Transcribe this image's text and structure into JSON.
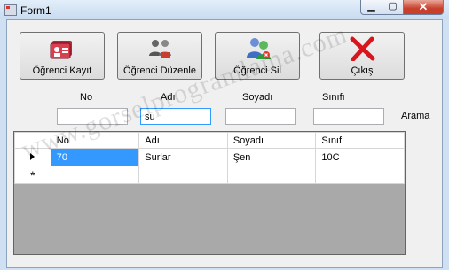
{
  "window": {
    "title": "Form1",
    "controls": {
      "minimize": "▁",
      "maximize": "▢",
      "close": "✕"
    }
  },
  "toolbar": {
    "buttons": [
      {
        "label": "Öğrenci Kayıt",
        "icon": "id-card-icon"
      },
      {
        "label": "Öğrenci Düzenle",
        "icon": "users-edit-icon"
      },
      {
        "label": "Öğrenci Sil",
        "icon": "user-delete-icon"
      },
      {
        "label": "Çıkış",
        "icon": "red-x-icon"
      }
    ]
  },
  "filters": {
    "no": {
      "label": "No",
      "value": ""
    },
    "adi": {
      "label": "Adı",
      "value": "su"
    },
    "soyadi": {
      "label": "Soyadı",
      "value": ""
    },
    "sinifi": {
      "label": "Sınıfı",
      "value": ""
    },
    "search_label": "Arama"
  },
  "grid": {
    "columns": [
      "No",
      "Adı",
      "Soyadı",
      "Sınıfı"
    ],
    "rows": [
      {
        "indicator": "current",
        "cells": [
          "70",
          "Surlar",
          "Şen",
          "10C"
        ]
      }
    ],
    "new_row_marker": "*"
  },
  "watermark": "www.gorselprogramlama.com",
  "colors": {
    "selection": "#3399ff",
    "grid_background": "#a9a9a9",
    "close_button": "#c8402b"
  }
}
